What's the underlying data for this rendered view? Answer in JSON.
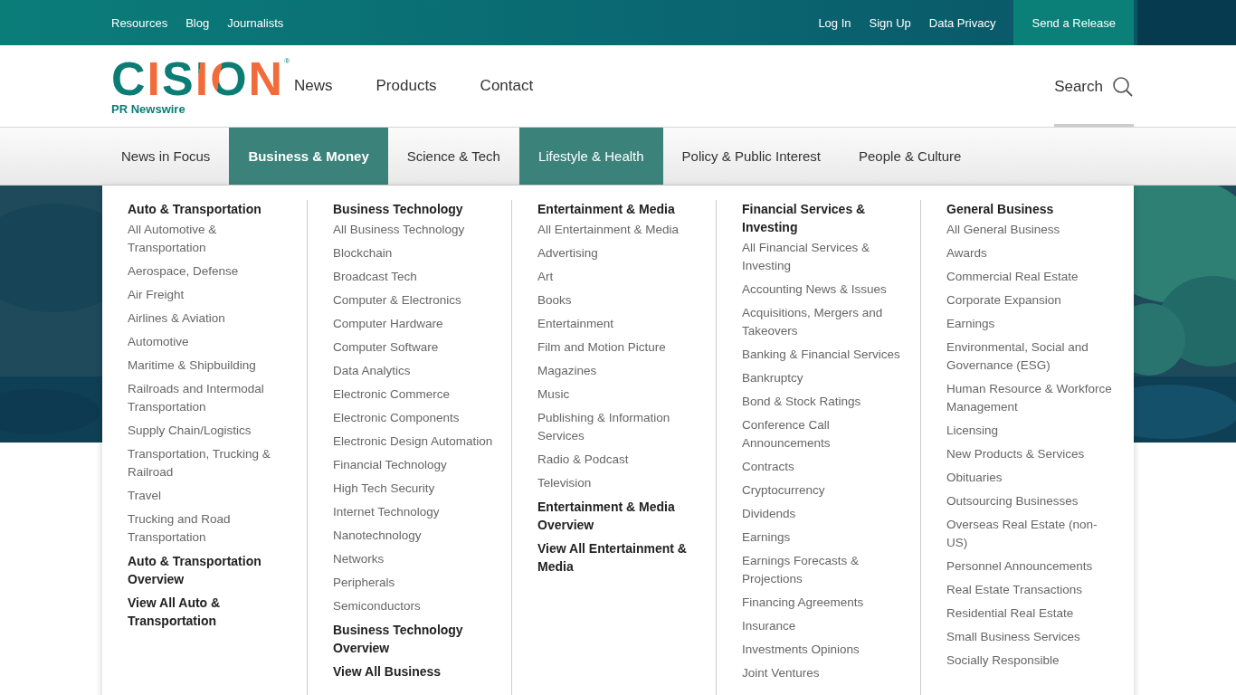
{
  "top_bar": {
    "left_links": [
      "Resources",
      "Blog",
      "Journalists"
    ],
    "right_links": [
      "Log In",
      "Sign Up",
      "Data Privacy"
    ],
    "cta": "Send a Release"
  },
  "header": {
    "logo": {
      "name": "CISION",
      "mark": "®",
      "tagline": "PR Newswire"
    },
    "nav": [
      "News",
      "Products",
      "Contact"
    ],
    "search": {
      "label": "Search"
    }
  },
  "categories": [
    {
      "label": "News in Focus",
      "selected": false,
      "highlighted": false
    },
    {
      "label": "Business & Money",
      "selected": true,
      "highlighted": true
    },
    {
      "label": "Science & Tech",
      "selected": false,
      "highlighted": false
    },
    {
      "label": "Lifestyle & Health",
      "selected": false,
      "highlighted": true
    },
    {
      "label": "Policy & Public Interest",
      "selected": false,
      "highlighted": false
    },
    {
      "label": "People & Culture",
      "selected": false,
      "highlighted": false
    }
  ],
  "menu_columns": [
    {
      "title": "Auto & Transportation",
      "items": [
        "All Automotive & Transportation",
        "Aerospace, Defense",
        "Air Freight",
        "Airlines & Aviation",
        "Automotive",
        "Maritime & Shipbuilding",
        "Railroads and Intermodal Transportation",
        "Supply Chain/Logistics",
        "Transportation, Trucking & Railroad",
        "Travel",
        "Trucking and Road Transportation"
      ],
      "links": [
        "Auto & Transportation Overview",
        "View All Auto & Transportation"
      ]
    },
    {
      "title": "Business Technology",
      "items": [
        "All Business Technology",
        "Blockchain",
        "Broadcast Tech",
        "Computer & Electronics",
        "Computer Hardware",
        "Computer Software",
        "Data Analytics",
        "Electronic Commerce",
        "Electronic Components",
        "Electronic Design Automation",
        "Financial Technology",
        "High Tech Security",
        "Internet Technology",
        "Nanotechnology",
        "Networks",
        "Peripherals",
        "Semiconductors"
      ],
      "links": [
        "Business Technology Overview",
        "View All Business"
      ]
    },
    {
      "title": "Entertainment & Media",
      "items": [
        "All Entertainment & Media",
        "Advertising",
        "Art",
        "Books",
        "Entertainment",
        "Film and Motion Picture",
        "Magazines",
        "Music",
        "Publishing & Information Services",
        "Radio & Podcast",
        "Television"
      ],
      "links": [
        "Entertainment & Media Overview",
        "View All Entertainment & Media"
      ]
    },
    {
      "title": "Financial Services & Investing",
      "items": [
        "All Financial Services & Investing",
        "Accounting News & Issues",
        "Acquisitions, Mergers and Takeovers",
        "Banking & Financial Services",
        "Bankruptcy",
        "Bond & Stock Ratings",
        "Conference Call Announcements",
        "Contracts",
        "Cryptocurrency",
        "Dividends",
        "Earnings",
        "Earnings Forecasts & Projections",
        "Financing Agreements",
        "Insurance",
        "Investments Opinions",
        "Joint Ventures"
      ]
    },
    {
      "title": "General Business",
      "items": [
        "All General Business",
        "Awards",
        "Commercial Real Estate",
        "Corporate Expansion",
        "Earnings",
        "Environmental, Social and Governance (ESG)",
        "Human Resource & Workforce Management",
        "Licensing",
        "New Products & Services",
        "Obituaries",
        "Outsourcing Businesses",
        "Overseas Real Estate (non-US)",
        "Personnel Announcements",
        "Real Estate Transactions",
        "Residential Real Estate",
        "Small Business Services",
        "Socially Responsible"
      ]
    }
  ]
}
